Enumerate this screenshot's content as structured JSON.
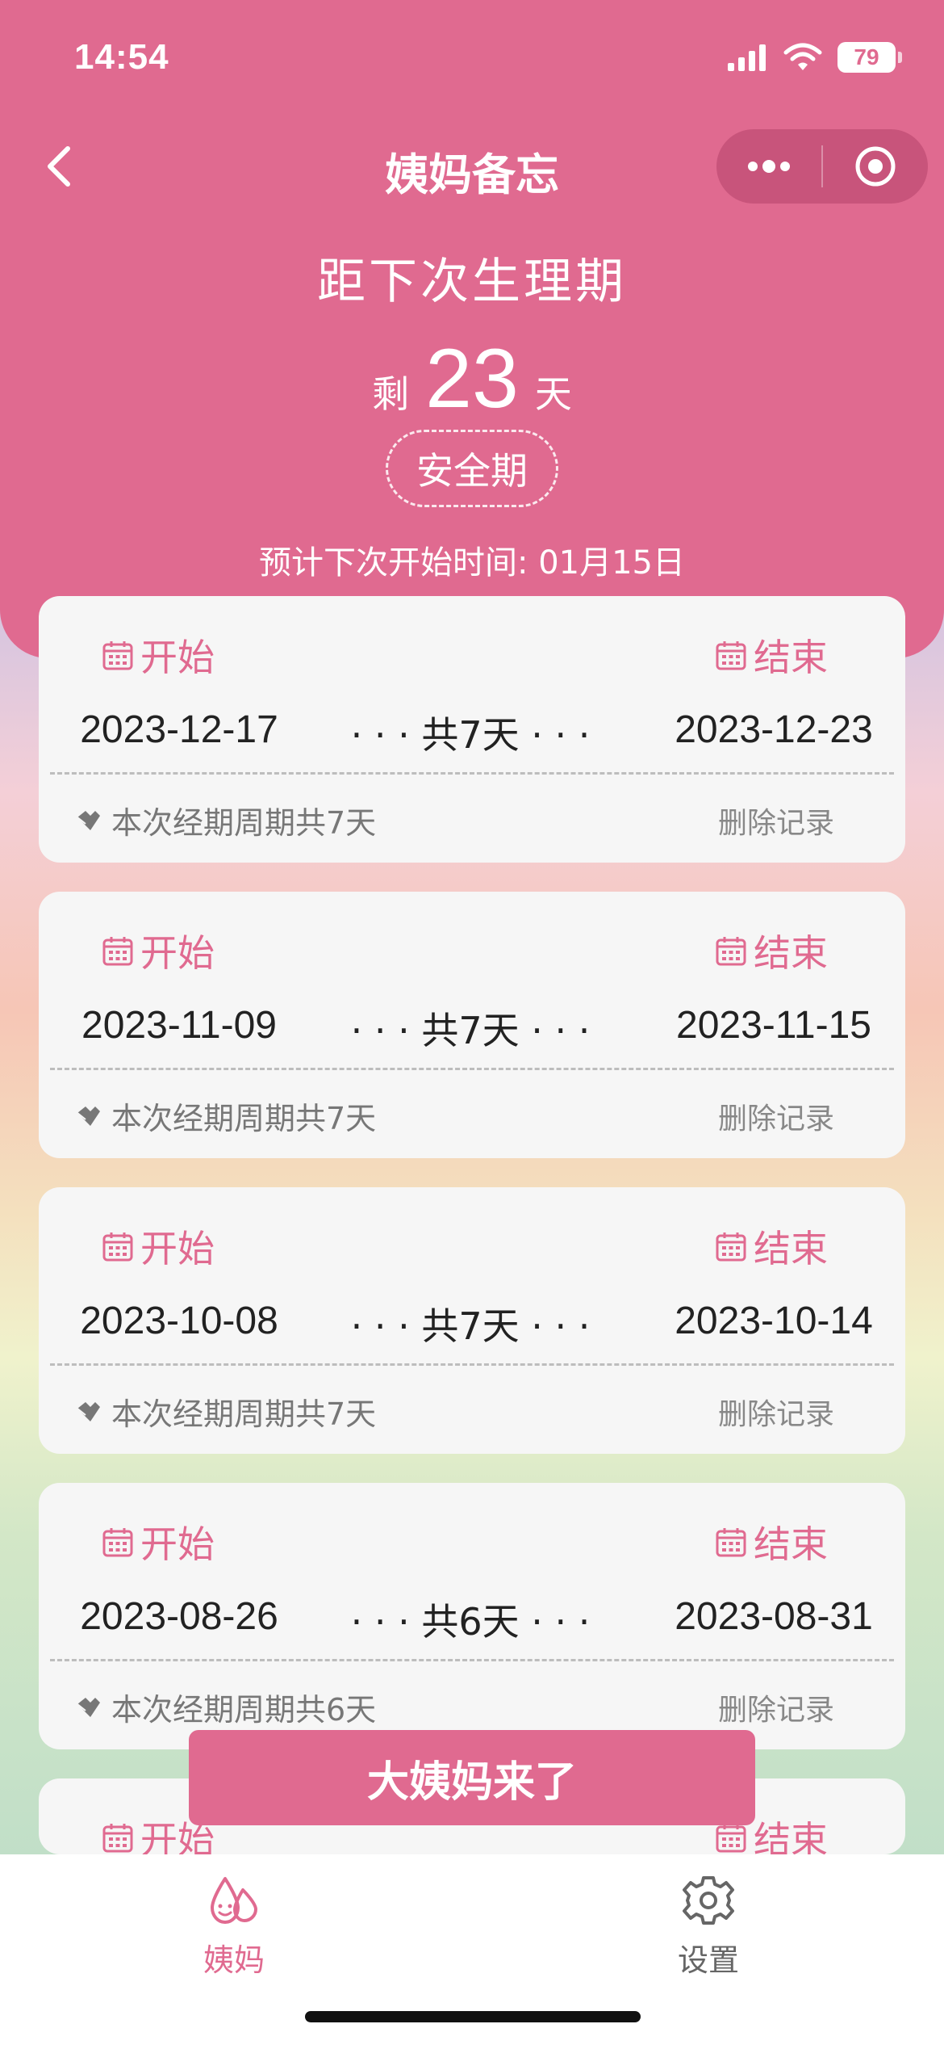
{
  "status_bar": {
    "time": "14:54",
    "battery": "79"
  },
  "nav": {
    "title": "姨妈备忘"
  },
  "summary": {
    "headline": "距下次生理期",
    "remaining_prefix": "剩",
    "remaining_days": "23",
    "remaining_suffix": "天",
    "phase": "安全期",
    "next_start": "预计下次开始时间: 01月15日"
  },
  "labels": {
    "start": "开始",
    "end": "结束",
    "delete": "删除记录"
  },
  "records": [
    {
      "start": "2023-12-17",
      "end": "2023-12-23",
      "duration": "· · · 共7天 · · ·",
      "cycle": "本次经期周期共7天"
    },
    {
      "start": "2023-11-09",
      "end": "2023-11-15",
      "duration": "· · · 共7天 · · ·",
      "cycle": "本次经期周期共7天"
    },
    {
      "start": "2023-10-08",
      "end": "2023-10-14",
      "duration": "· · · 共7天 · · ·",
      "cycle": "本次经期周期共7天"
    },
    {
      "start": "2023-08-26",
      "end": "2023-08-31",
      "duration": "· · · 共6天 · · ·",
      "cycle": "本次经期周期共6天"
    }
  ],
  "action_button": "大姨妈来了",
  "tabbar": {
    "home": "姨妈",
    "settings": "设置"
  },
  "colors": {
    "accent": "#e06a90"
  }
}
